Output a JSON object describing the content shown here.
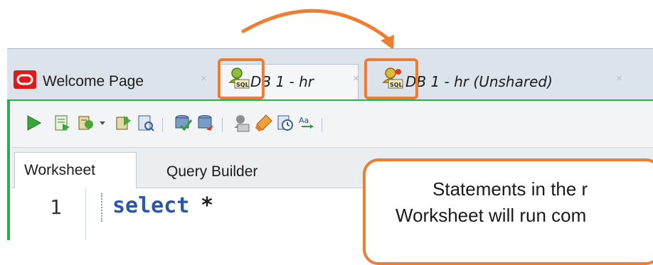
{
  "tabs": [
    {
      "label": "Welcome Page",
      "close": "×",
      "icon": "oracle-logo-icon"
    },
    {
      "label": "DB 1 - hr",
      "close": "×",
      "icon": "sql-connection-icon"
    },
    {
      "label": "DB 1 - hr (Unshared)",
      "close": "×",
      "icon": "unshared-sql-connection-icon"
    }
  ],
  "toolbar": {
    "icons": [
      "run-statement-icon",
      "run-script-icon",
      "autotrace-icon",
      "dropdown-arrow-icon",
      "explain-plan-icon",
      "sql-tuning-advisor-icon",
      "commit-icon",
      "rollback-icon",
      "unshared-sql-worksheet-icon",
      "clear-icon",
      "sql-history-icon",
      "to-upper-lower-icon"
    ]
  },
  "subtabs": {
    "worksheet": "Worksheet",
    "query_builder": "Query Builder"
  },
  "editor": {
    "line_number": "1",
    "keyword": "select",
    "operator": "*"
  },
  "callout": {
    "line1": "Statements in the r",
    "line2": "Worksheet will run com"
  },
  "colors": {
    "highlight": "#ed7d31",
    "active_frame": "#22b14c",
    "keyword": "#2b57a8"
  }
}
